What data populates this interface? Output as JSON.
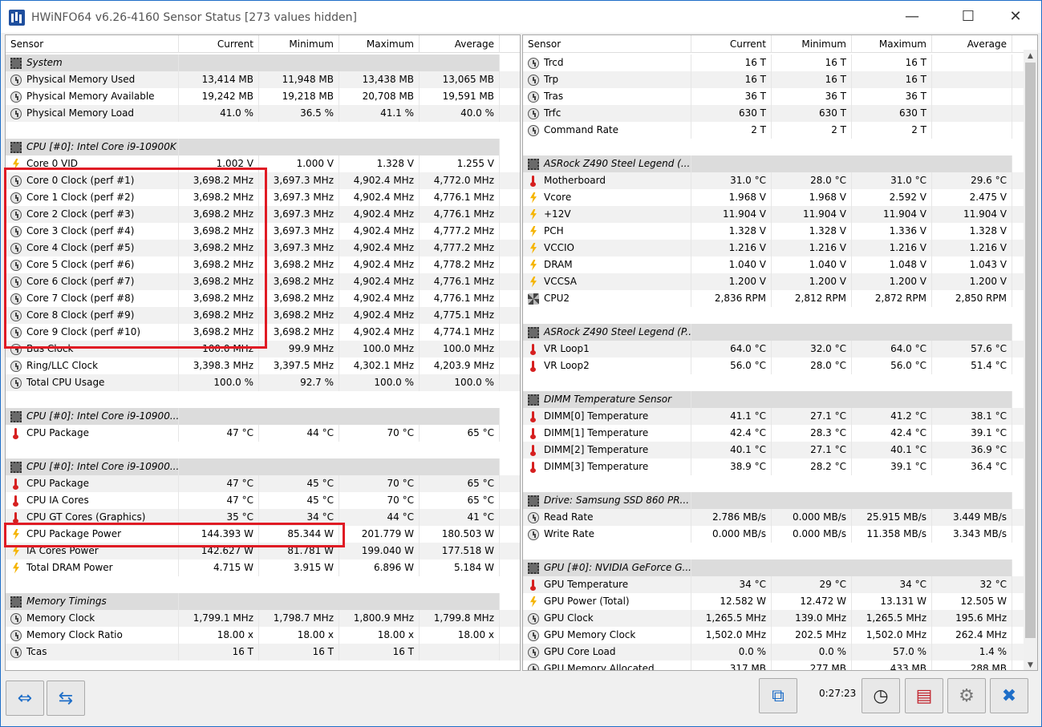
{
  "window": {
    "title": "HWiNFO64 v6.26-4160 Sensor Status [273 values hidden]",
    "minimize": "—",
    "maximize": "☐",
    "close": "✕"
  },
  "columns": {
    "sensor": "Sensor",
    "current": "Current",
    "minimum": "Minimum",
    "maximum": "Maximum",
    "average": "Average"
  },
  "left_rows": [
    {
      "type": "group",
      "name": "System",
      "icon": "chip"
    },
    {
      "type": "data",
      "icon": "clock",
      "name": "Physical Memory Used",
      "cur": "13,414 MB",
      "min": "11,948 MB",
      "max": "13,438 MB",
      "avg": "13,065 MB"
    },
    {
      "type": "data",
      "icon": "clock",
      "name": "Physical Memory Available",
      "cur": "19,242 MB",
      "min": "19,218 MB",
      "max": "20,708 MB",
      "avg": "19,591 MB"
    },
    {
      "type": "data",
      "icon": "clock",
      "name": "Physical Memory Load",
      "cur": "41.0 %",
      "min": "36.5 %",
      "max": "41.1 %",
      "avg": "40.0 %"
    },
    {
      "type": "blank"
    },
    {
      "type": "group",
      "name": "CPU [#0]: Intel Core i9-10900K",
      "icon": "chip"
    },
    {
      "type": "data",
      "icon": "bolt",
      "name": "Core 0 VID",
      "cur": "1.002 V",
      "min": "1.000 V",
      "max": "1.328 V",
      "avg": "1.255 V"
    },
    {
      "type": "data",
      "icon": "clock",
      "name": "Core 0 Clock (perf #1)",
      "cur": "3,698.2 MHz",
      "min": "3,697.3 MHz",
      "max": "4,902.4 MHz",
      "avg": "4,772.0 MHz"
    },
    {
      "type": "data",
      "icon": "clock",
      "name": "Core 1 Clock (perf #2)",
      "cur": "3,698.2 MHz",
      "min": "3,697.3 MHz",
      "max": "4,902.4 MHz",
      "avg": "4,776.1 MHz"
    },
    {
      "type": "data",
      "icon": "clock",
      "name": "Core 2 Clock (perf #3)",
      "cur": "3,698.2 MHz",
      "min": "3,697.3 MHz",
      "max": "4,902.4 MHz",
      "avg": "4,776.1 MHz"
    },
    {
      "type": "data",
      "icon": "clock",
      "name": "Core 3 Clock (perf #4)",
      "cur": "3,698.2 MHz",
      "min": "3,697.3 MHz",
      "max": "4,902.4 MHz",
      "avg": "4,777.2 MHz"
    },
    {
      "type": "data",
      "icon": "clock",
      "name": "Core 4 Clock (perf #5)",
      "cur": "3,698.2 MHz",
      "min": "3,697.3 MHz",
      "max": "4,902.4 MHz",
      "avg": "4,777.2 MHz"
    },
    {
      "type": "data",
      "icon": "clock",
      "name": "Core 5 Clock (perf #6)",
      "cur": "3,698.2 MHz",
      "min": "3,698.2 MHz",
      "max": "4,902.4 MHz",
      "avg": "4,778.2 MHz"
    },
    {
      "type": "data",
      "icon": "clock",
      "name": "Core 6 Clock (perf #7)",
      "cur": "3,698.2 MHz",
      "min": "3,698.2 MHz",
      "max": "4,902.4 MHz",
      "avg": "4,776.1 MHz"
    },
    {
      "type": "data",
      "icon": "clock",
      "name": "Core 7 Clock (perf #8)",
      "cur": "3,698.2 MHz",
      "min": "3,698.2 MHz",
      "max": "4,902.4 MHz",
      "avg": "4,776.1 MHz"
    },
    {
      "type": "data",
      "icon": "clock",
      "name": "Core 8 Clock (perf #9)",
      "cur": "3,698.2 MHz",
      "min": "3,698.2 MHz",
      "max": "4,902.4 MHz",
      "avg": "4,775.1 MHz"
    },
    {
      "type": "data",
      "icon": "clock",
      "name": "Core 9 Clock (perf #10)",
      "cur": "3,698.2 MHz",
      "min": "3,698.2 MHz",
      "max": "4,902.4 MHz",
      "avg": "4,774.1 MHz"
    },
    {
      "type": "data",
      "icon": "clock",
      "name": "Bus Clock",
      "cur": "100.0 MHz",
      "min": "99.9 MHz",
      "max": "100.0 MHz",
      "avg": "100.0 MHz"
    },
    {
      "type": "data",
      "icon": "clock",
      "name": "Ring/LLC Clock",
      "cur": "3,398.3 MHz",
      "min": "3,397.5 MHz",
      "max": "4,302.1 MHz",
      "avg": "4,203.9 MHz"
    },
    {
      "type": "data",
      "icon": "clock",
      "name": "Total CPU Usage",
      "cur": "100.0 %",
      "min": "92.7 %",
      "max": "100.0 %",
      "avg": "100.0 %"
    },
    {
      "type": "blank"
    },
    {
      "type": "group",
      "name": "CPU [#0]: Intel Core i9-10900...",
      "icon": "chip"
    },
    {
      "type": "data",
      "icon": "therm",
      "name": "CPU Package",
      "cur": "47 °C",
      "min": "44 °C",
      "max": "70 °C",
      "avg": "65 °C"
    },
    {
      "type": "blank"
    },
    {
      "type": "group",
      "name": "CPU [#0]: Intel Core i9-10900...",
      "icon": "chip"
    },
    {
      "type": "data",
      "icon": "therm",
      "name": "CPU Package",
      "cur": "47 °C",
      "min": "45 °C",
      "max": "70 °C",
      "avg": "65 °C"
    },
    {
      "type": "data",
      "icon": "therm",
      "name": "CPU IA Cores",
      "cur": "47 °C",
      "min": "45 °C",
      "max": "70 °C",
      "avg": "65 °C"
    },
    {
      "type": "data",
      "icon": "therm",
      "name": "CPU GT Cores (Graphics)",
      "cur": "35 °C",
      "min": "34 °C",
      "max": "44 °C",
      "avg": "41 °C"
    },
    {
      "type": "data",
      "icon": "bolt",
      "name": "CPU Package Power",
      "cur": "144.393 W",
      "min": "85.344 W",
      "max": "201.779 W",
      "avg": "180.503 W"
    },
    {
      "type": "data",
      "icon": "bolt",
      "name": "IA Cores Power",
      "cur": "142.627 W",
      "min": "81.781 W",
      "max": "199.040 W",
      "avg": "177.518 W"
    },
    {
      "type": "data",
      "icon": "bolt",
      "name": "Total DRAM Power",
      "cur": "4.715 W",
      "min": "3.915 W",
      "max": "6.896 W",
      "avg": "5.184 W"
    },
    {
      "type": "blank"
    },
    {
      "type": "group",
      "name": "Memory Timings",
      "icon": "chip"
    },
    {
      "type": "data",
      "icon": "clock",
      "name": "Memory Clock",
      "cur": "1,799.1 MHz",
      "min": "1,798.7 MHz",
      "max": "1,800.9 MHz",
      "avg": "1,799.8 MHz"
    },
    {
      "type": "data",
      "icon": "clock",
      "name": "Memory Clock Ratio",
      "cur": "18.00 x",
      "min": "18.00 x",
      "max": "18.00 x",
      "avg": "18.00 x"
    },
    {
      "type": "data",
      "icon": "clock",
      "name": "Tcas",
      "cur": "16 T",
      "min": "16 T",
      "max": "16 T",
      "avg": ""
    }
  ],
  "right_rows": [
    {
      "type": "data",
      "icon": "clock",
      "name": "Trcd",
      "cur": "16 T",
      "min": "16 T",
      "max": "16 T",
      "avg": ""
    },
    {
      "type": "data",
      "icon": "clock",
      "name": "Trp",
      "cur": "16 T",
      "min": "16 T",
      "max": "16 T",
      "avg": ""
    },
    {
      "type": "data",
      "icon": "clock",
      "name": "Tras",
      "cur": "36 T",
      "min": "36 T",
      "max": "36 T",
      "avg": ""
    },
    {
      "type": "data",
      "icon": "clock",
      "name": "Trfc",
      "cur": "630 T",
      "min": "630 T",
      "max": "630 T",
      "avg": ""
    },
    {
      "type": "data",
      "icon": "clock",
      "name": "Command Rate",
      "cur": "2 T",
      "min": "2 T",
      "max": "2 T",
      "avg": ""
    },
    {
      "type": "blank"
    },
    {
      "type": "group",
      "name": "ASRock Z490 Steel Legend (...",
      "icon": "chip"
    },
    {
      "type": "data",
      "icon": "therm",
      "name": "Motherboard",
      "cur": "31.0 °C",
      "min": "28.0 °C",
      "max": "31.0 °C",
      "avg": "29.6 °C"
    },
    {
      "type": "data",
      "icon": "bolt",
      "name": "Vcore",
      "cur": "1.968 V",
      "min": "1.968 V",
      "max": "2.592 V",
      "avg": "2.475 V"
    },
    {
      "type": "data",
      "icon": "bolt",
      "name": "+12V",
      "cur": "11.904 V",
      "min": "11.904 V",
      "max": "11.904 V",
      "avg": "11.904 V"
    },
    {
      "type": "data",
      "icon": "bolt",
      "name": "PCH",
      "cur": "1.328 V",
      "min": "1.328 V",
      "max": "1.336 V",
      "avg": "1.328 V"
    },
    {
      "type": "data",
      "icon": "bolt",
      "name": "VCCIO",
      "cur": "1.216 V",
      "min": "1.216 V",
      "max": "1.216 V",
      "avg": "1.216 V"
    },
    {
      "type": "data",
      "icon": "bolt",
      "name": "DRAM",
      "cur": "1.040 V",
      "min": "1.040 V",
      "max": "1.048 V",
      "avg": "1.043 V"
    },
    {
      "type": "data",
      "icon": "bolt",
      "name": "VCCSA",
      "cur": "1.200 V",
      "min": "1.200 V",
      "max": "1.200 V",
      "avg": "1.200 V"
    },
    {
      "type": "data",
      "icon": "fan",
      "name": "CPU2",
      "cur": "2,836 RPM",
      "min": "2,812 RPM",
      "max": "2,872 RPM",
      "avg": "2,850 RPM"
    },
    {
      "type": "blank"
    },
    {
      "type": "group",
      "name": "ASRock Z490 Steel Legend (P...",
      "icon": "chip"
    },
    {
      "type": "data",
      "icon": "therm",
      "name": "VR Loop1",
      "cur": "64.0 °C",
      "min": "32.0 °C",
      "max": "64.0 °C",
      "avg": "57.6 °C"
    },
    {
      "type": "data",
      "icon": "therm",
      "name": "VR Loop2",
      "cur": "56.0 °C",
      "min": "28.0 °C",
      "max": "56.0 °C",
      "avg": "51.4 °C"
    },
    {
      "type": "blank"
    },
    {
      "type": "group",
      "name": "DIMM Temperature Sensor",
      "icon": "chip"
    },
    {
      "type": "data",
      "icon": "therm",
      "name": "DIMM[0] Temperature",
      "cur": "41.1 °C",
      "min": "27.1 °C",
      "max": "41.2 °C",
      "avg": "38.1 °C"
    },
    {
      "type": "data",
      "icon": "therm",
      "name": "DIMM[1] Temperature",
      "cur": "42.4 °C",
      "min": "28.3 °C",
      "max": "42.4 °C",
      "avg": "39.1 °C"
    },
    {
      "type": "data",
      "icon": "therm",
      "name": "DIMM[2] Temperature",
      "cur": "40.1 °C",
      "min": "27.1 °C",
      "max": "40.1 °C",
      "avg": "36.9 °C"
    },
    {
      "type": "data",
      "icon": "therm",
      "name": "DIMM[3] Temperature",
      "cur": "38.9 °C",
      "min": "28.2 °C",
      "max": "39.1 °C",
      "avg": "36.4 °C"
    },
    {
      "type": "blank"
    },
    {
      "type": "group",
      "name": "Drive: Samsung SSD 860 PR...",
      "icon": "chip"
    },
    {
      "type": "data",
      "icon": "clock",
      "name": "Read Rate",
      "cur": "2.786 MB/s",
      "min": "0.000 MB/s",
      "max": "25.915 MB/s",
      "avg": "3.449 MB/s"
    },
    {
      "type": "data",
      "icon": "clock",
      "name": "Write Rate",
      "cur": "0.000 MB/s",
      "min": "0.000 MB/s",
      "max": "11.358 MB/s",
      "avg": "3.343 MB/s"
    },
    {
      "type": "blank"
    },
    {
      "type": "group",
      "name": "GPU [#0]: NVIDIA GeForce G...",
      "icon": "chip"
    },
    {
      "type": "data",
      "icon": "therm",
      "name": "GPU Temperature",
      "cur": "34 °C",
      "min": "29 °C",
      "max": "34 °C",
      "avg": "32 °C"
    },
    {
      "type": "data",
      "icon": "bolt",
      "name": "GPU Power (Total)",
      "cur": "12.582 W",
      "min": "12.472 W",
      "max": "13.131 W",
      "avg": "12.505 W"
    },
    {
      "type": "data",
      "icon": "clock",
      "name": "GPU Clock",
      "cur": "1,265.5 MHz",
      "min": "139.0 MHz",
      "max": "1,265.5 MHz",
      "avg": "195.6 MHz"
    },
    {
      "type": "data",
      "icon": "clock",
      "name": "GPU Memory Clock",
      "cur": "1,502.0 MHz",
      "min": "202.5 MHz",
      "max": "1,502.0 MHz",
      "avg": "262.4 MHz"
    },
    {
      "type": "data",
      "icon": "clock",
      "name": "GPU Core Load",
      "cur": "0.0 %",
      "min": "0.0 %",
      "max": "57.0 %",
      "avg": "1.4 %"
    },
    {
      "type": "data",
      "icon": "clock",
      "name": "GPU Memory Allocated",
      "cur": "317 MB",
      "min": "277 MB",
      "max": "433 MB",
      "avg": "288 MB"
    }
  ],
  "toolbar": {
    "expand_icon": "expand-arrows-icon",
    "collapse_icon": "collapse-arrows-icon",
    "timer": "0:27:23"
  },
  "colors": {
    "highlight": "#e01b24",
    "accent": "#1e6ec8"
  }
}
